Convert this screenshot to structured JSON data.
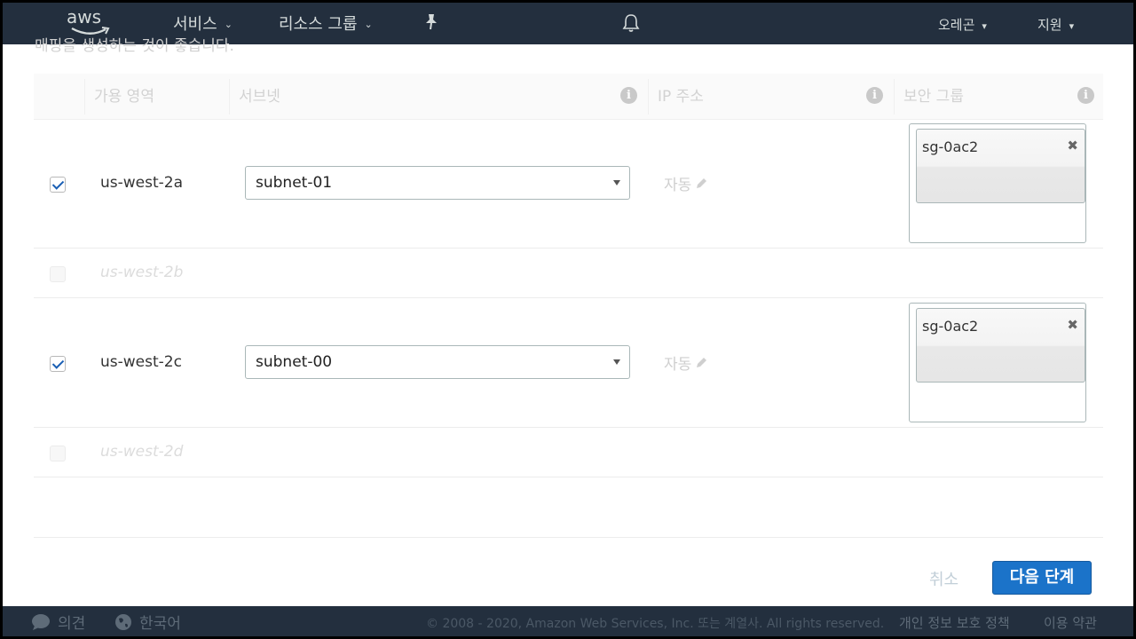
{
  "nav": {
    "logo": "aws",
    "services": "서비스",
    "resource_groups": "리소스 그룹",
    "region": "오레곤",
    "support": "지원"
  },
  "hidden_text": "매핑을 생성하는 것이 좋습니다.",
  "table": {
    "headers": [
      "가용 영역",
      "서브넷",
      "IP 주소",
      "보안 그룹"
    ],
    "rows": [
      {
        "checked": true,
        "az": "us-west-2a",
        "subnet": "subnet-01",
        "ip": "자동",
        "sg": "sg-0ac2"
      },
      {
        "checked": false,
        "az": "us-west-2b"
      },
      {
        "checked": true,
        "az": "us-west-2c",
        "subnet": "subnet-00",
        "ip": "자동",
        "sg": "sg-0ac2"
      },
      {
        "checked": false,
        "az": "us-west-2d"
      }
    ]
  },
  "actions": {
    "cancel": "취소",
    "next": "다음 단계"
  },
  "footer": {
    "feedback": "의견",
    "language": "한국어",
    "copyright": "© 2008 - 2020, Amazon Web Services, Inc. 또는 계열사. All rights reserved.",
    "privacy": "개인 정보 보호 정책",
    "terms": "이용 약관"
  }
}
